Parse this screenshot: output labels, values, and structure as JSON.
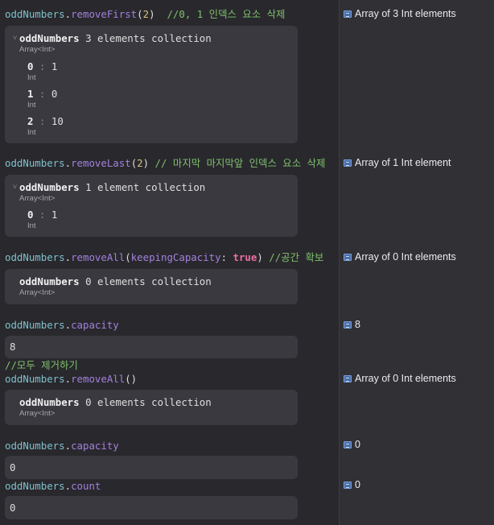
{
  "lines": [
    {
      "ident": "oddNumbers",
      "dot": ".",
      "member": "removeFirst",
      "open": "(",
      "arg": "2",
      "close": ")",
      "comment": "  //0, 1 인덱스 요소 삭제"
    },
    {
      "ident": "oddNumbers",
      "dot": ".",
      "member": "removeLast",
      "open": "(",
      "arg": "2",
      "close": ")",
      "comment": " // 마지막 마지막앞 인덱스 요소 삭제"
    },
    {
      "ident": "oddNumbers",
      "dot": ".",
      "member": "removeAll",
      "open": "(",
      "param": "keepingCapacity",
      "colon": ": ",
      "kw": "true",
      "close": ")",
      "comment": " //공간 확보"
    },
    {
      "ident": "oddNumbers",
      "dot": ".",
      "member": "capacity"
    },
    {
      "comment": "//모두 제거하기"
    },
    {
      "ident": "oddNumbers",
      "dot": ".",
      "member": "removeAll",
      "paren": "()"
    },
    {
      "ident": "oddNumbers",
      "dot": ".",
      "member": "capacity"
    },
    {
      "ident": "oddNumbers",
      "dot": ".",
      "member": "count"
    }
  ],
  "panels": [
    {
      "chevron": "˅",
      "name": "oddNumbers",
      "desc": " 3 elements collection",
      "type": "Array<Int>",
      "rows": [
        {
          "index": "0",
          "sep": " : ",
          "value": "1",
          "type": "Int"
        },
        {
          "index": "1",
          "sep": " : ",
          "value": "0",
          "type": "Int"
        },
        {
          "index": "2",
          "sep": " : ",
          "value": "10",
          "type": "Int"
        }
      ]
    },
    {
      "chevron": "˅",
      "name": "oddNumbers",
      "desc": " 1 element collection",
      "type": "Array<Int>",
      "rows": [
        {
          "index": "0",
          "sep": " : ",
          "value": "1",
          "type": "Int"
        }
      ]
    },
    {
      "name": "oddNumbers",
      "desc": " 0 elements collection",
      "type": "Array<Int>"
    },
    {
      "value": "8"
    },
    {
      "name": "oddNumbers",
      "desc": " 0 elements collection",
      "type": "Array<Int>"
    },
    {
      "value": "0"
    },
    {
      "value": "0"
    }
  ],
  "results": [
    {
      "icon": "result-quicklook-icon",
      "label": "Array of 3 Int elements"
    },
    {
      "icon": "result-quicklook-icon",
      "label": "Array of 1 Int element"
    },
    {
      "icon": "result-quicklook-icon",
      "label": "Array of 0 Int elements"
    },
    {
      "icon": "result-quicklook-icon",
      "label": "8"
    },
    {
      "icon": "result-quicklook-icon",
      "label": "Array of 0 Int elements"
    },
    {
      "icon": "result-quicklook-icon",
      "label": "0"
    },
    {
      "icon": "result-quicklook-icon",
      "label": "0"
    }
  ],
  "colors": {
    "background": "#29282d",
    "gutter": "#303035",
    "panel": "#3a393f",
    "identifier": "#7fc1ca",
    "method": "#a381dd",
    "number": "#d6c47a",
    "keyword": "#ee6da3",
    "comment": "#7ec16c"
  }
}
